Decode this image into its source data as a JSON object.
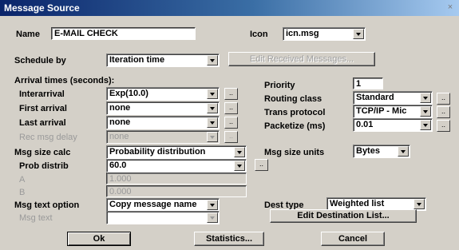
{
  "window": {
    "title": "Message Source",
    "close_glyph": "×"
  },
  "name": {
    "label": "Name",
    "value": "E-MAIL CHECK"
  },
  "icon": {
    "label": "Icon",
    "value": "icn.msg"
  },
  "schedule": {
    "label": "Schedule by",
    "value": "Iteration time",
    "edit_button": "Edit Received Messages..."
  },
  "arrival": {
    "heading": "Arrival times (seconds):",
    "interarrival": {
      "label": "Interarrival",
      "value": "Exp(10.0)"
    },
    "first": {
      "label": "First arrival",
      "value": "none"
    },
    "last": {
      "label": "Last arrival",
      "value": "none"
    },
    "rec_delay": {
      "label": "Rec msg delay",
      "value": "none"
    },
    "dots": ".."
  },
  "priority": {
    "label": "Priority",
    "value": "1"
  },
  "routing": {
    "label": "Routing class",
    "value": "Standard"
  },
  "trans": {
    "label": "Trans protocol",
    "value": "TCP/IP - Mic"
  },
  "packetize": {
    "label": "Packetize (ms)",
    "value": "0.01"
  },
  "msgsize": {
    "label": "Msg size calc",
    "value": "Probability distribution"
  },
  "msgunits": {
    "label": "Msg size units",
    "value": "Bytes"
  },
  "prob": {
    "label": "Prob distrib",
    "value": "60.0"
  },
  "a": {
    "label": "A",
    "value": "1.000"
  },
  "b": {
    "label": "B",
    "value": "0.000"
  },
  "textopt": {
    "label": "Msg text option",
    "value": "Copy message name"
  },
  "msgtext": {
    "label": "Msg text",
    "value": ""
  },
  "dest": {
    "label": "Dest type",
    "value": "Weighted list",
    "edit_button": "Edit Destination List..."
  },
  "buttons": {
    "ok": "Ok",
    "statistics": "Statistics...",
    "cancel": "Cancel"
  }
}
